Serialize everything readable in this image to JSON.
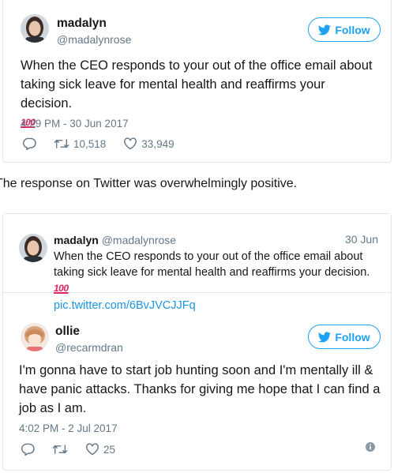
{
  "tweet1": {
    "author": {
      "name": "madalyn",
      "handle": "@madalynrose"
    },
    "follow_label": "Follow",
    "text": "When the CEO responds to your out of the office email about taking sick leave for mental health and reaffirms your decision.",
    "emoji": "100",
    "timestamp": "4:29 PM - 30 Jun 2017",
    "reply_count": "",
    "retweet_count": "10,518",
    "like_count": "33,949"
  },
  "between_text": "The response on Twitter was overwhelmingly positive.",
  "tweet2": {
    "quoted": {
      "name": "madalyn",
      "handle": "@madalynrose",
      "date": "30 Jun",
      "text": "When the CEO responds to your out of the office email about taking sick leave for mental health and reaffirms your decision.",
      "emoji": "100",
      "link": "pic.twitter.com/6BvJVCJJFq"
    },
    "author": {
      "name": "ollie",
      "handle": "@recarmdran"
    },
    "follow_label": "Follow",
    "text": "I'm gonna have to start job hunting soon and I'm mentally ill & have panic attacks. Thanks for giving me hope that I can find a job as I am.",
    "timestamp": "4:02 PM - 2 Jul 2017",
    "like_count": "25"
  },
  "colors": {
    "accent": "#1da1f2",
    "link": "#1b95e0",
    "muted": "#657786",
    "border": "#e1e8ed",
    "emoji": "#e0245e"
  },
  "icons": [
    "twitter-bird-icon",
    "reply-icon",
    "retweet-icon",
    "heart-icon",
    "info-icon",
    "hundred-points-emoji"
  ]
}
